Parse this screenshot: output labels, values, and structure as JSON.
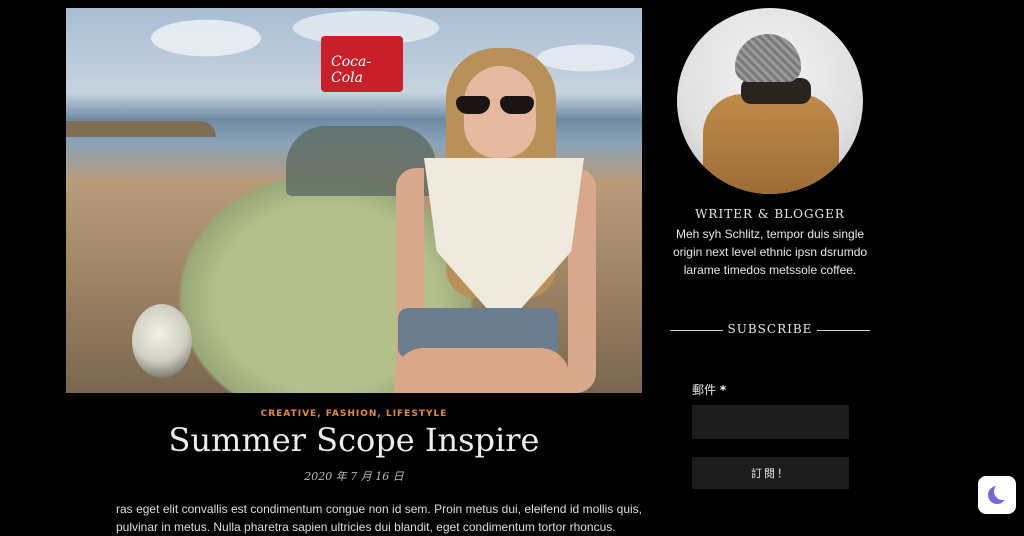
{
  "post": {
    "categories": [
      "CREATIVE",
      "FASHION",
      "LIFESTYLE"
    ],
    "title": "Summer Scope Inspire",
    "date": "2020 年 7 月 16 日",
    "excerpt": "ras eget elit convallis est condimentum congue non id sem. Proin metus dui, eleifend id mollis quis, pulvinar in metus. Nulla pharetra sapien ultricies dui blandit, eget condimentum tortor rhoncus.",
    "image_brand_text": "Coca-Cola"
  },
  "sidebar": {
    "bio_heading": "WRITER & BLOGGER",
    "bio_text": "Meh syh Schlitz, tempor duis single origin next level ethnic ipsn dsrumdo larame timedos metssole coffee.",
    "subscribe_heading": "SUBSCRIBE",
    "email_label": "郵件",
    "email_required_mark": "*",
    "email_value": "",
    "subscribe_button": "訂閱！"
  },
  "colors": {
    "background": "#000000",
    "category_accent": "#e8883a",
    "input_bg": "#1c1c1c",
    "moon_icon": "#6f6ad8"
  },
  "icons": {
    "dark_mode_toggle": "moon-icon"
  }
}
